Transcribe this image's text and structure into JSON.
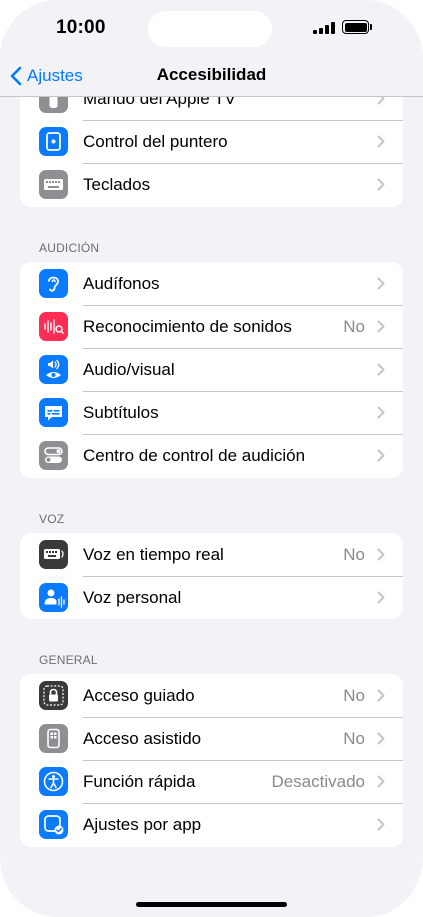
{
  "status": {
    "time": "10:00"
  },
  "nav": {
    "back_label": "Ajustes",
    "title": "Accesibilidad"
  },
  "group0": {
    "items": [
      {
        "label": "Mando del Apple TV",
        "value": "",
        "icon": "apple-tv-remote-icon",
        "color": "#8e8e93"
      },
      {
        "label": "Control del puntero",
        "value": "",
        "icon": "pointer-control-icon",
        "color": "#0a7aff"
      },
      {
        "label": "Teclados",
        "value": "",
        "icon": "keyboard-icon",
        "color": "#8e8e93"
      }
    ]
  },
  "sections": {
    "hearing": "AUDICIÓN",
    "speech": "VOZ",
    "general": "GENERAL"
  },
  "hearing": {
    "items": [
      {
        "label": "Audífonos",
        "value": "",
        "icon": "ear-icon",
        "color": "#0a7aff"
      },
      {
        "label": "Reconocimiento de sonidos",
        "value": "No",
        "icon": "sound-recognition-icon",
        "color": "#ff2d55"
      },
      {
        "label": "Audio/visual",
        "value": "",
        "icon": "audio-visual-icon",
        "color": "#0a7aff"
      },
      {
        "label": "Subtítulos",
        "value": "",
        "icon": "subtitles-icon",
        "color": "#0a7aff"
      },
      {
        "label": "Centro de control de audición",
        "value": "",
        "icon": "toggles-icon",
        "color": "#8e8e93"
      }
    ]
  },
  "speech": {
    "items": [
      {
        "label": "Voz en tiempo real",
        "value": "No",
        "icon": "live-speech-keyboard-icon",
        "color": "#3a3a3c"
      },
      {
        "label": "Voz personal",
        "value": "",
        "icon": "personal-voice-icon",
        "color": "#0a7aff"
      }
    ]
  },
  "general": {
    "items": [
      {
        "label": "Acceso guiado",
        "value": "No",
        "icon": "lock-icon",
        "color": "#3a3a3c"
      },
      {
        "label": "Acceso asistido",
        "value": "No",
        "icon": "assistive-access-icon",
        "color": "#8e8e93"
      },
      {
        "label": "Función rápida",
        "value": "Desactivado",
        "icon": "accessibility-icon",
        "color": "#0a7aff"
      },
      {
        "label": "Ajustes por app",
        "value": "",
        "icon": "per-app-settings-icon",
        "color": "#0a7aff"
      }
    ]
  }
}
